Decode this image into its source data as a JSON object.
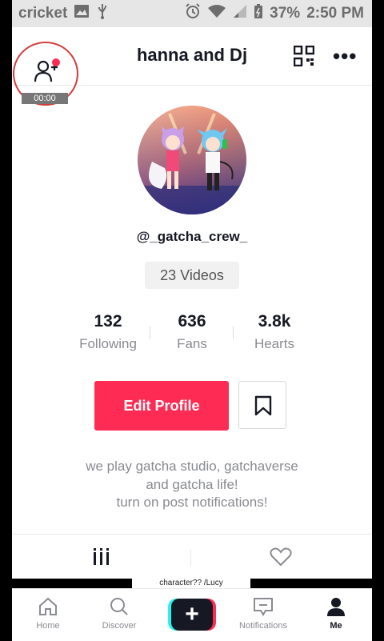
{
  "status_bar": {
    "carrier": "cricket",
    "battery_percent": "37%",
    "time": "2:50 PM"
  },
  "header": {
    "title": "hanna and Dj",
    "add_friend_timer": "00:00"
  },
  "profile": {
    "username": "@_gatcha_crew_",
    "videos_label": "23 Videos",
    "stats": [
      {
        "value": "132",
        "label": "Following"
      },
      {
        "value": "636",
        "label": "Fans"
      },
      {
        "value": "3.8k",
        "label": "Hearts"
      }
    ],
    "edit_profile_label": "Edit Profile",
    "bio_lines": [
      "we play gatcha studio, gatchaverse",
      "and gatcha life!",
      "turn on post notifications!"
    ]
  },
  "content": {
    "thumb_caption": "character?? /Lucy"
  },
  "bottom_nav": {
    "items": [
      {
        "label": "Home"
      },
      {
        "label": "Discover"
      },
      {
        "label": "Notifications"
      },
      {
        "label": "Me"
      }
    ]
  },
  "colors": {
    "accent": "#fe2c55",
    "text_primary": "#161823",
    "text_secondary": "#8a8b91"
  }
}
